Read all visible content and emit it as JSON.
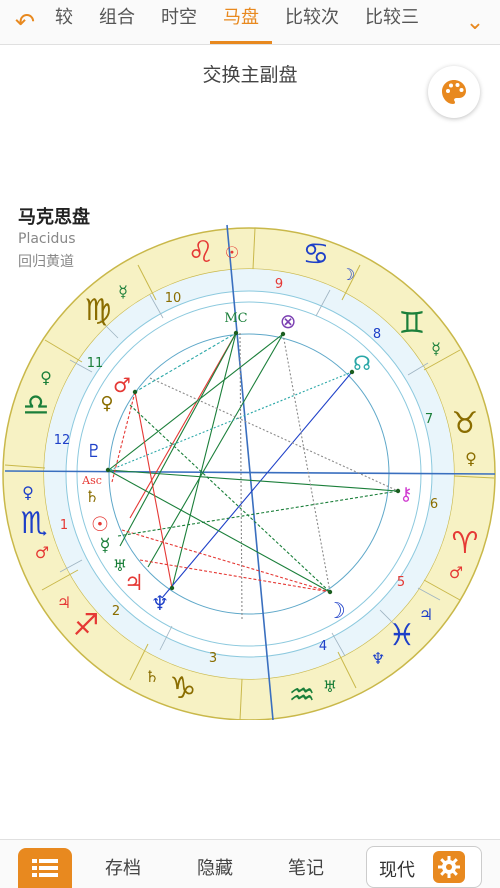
{
  "tabs": {
    "back_icon": "undo-arrow-icon",
    "items": [
      {
        "label": "较",
        "active": false
      },
      {
        "label": "组合",
        "active": false
      },
      {
        "label": "时空",
        "active": false
      },
      {
        "label": "马盘",
        "active": true
      },
      {
        "label": "比较次",
        "active": false
      },
      {
        "label": "比较三",
        "active": false
      }
    ],
    "more_icon": "chevron-down-icon"
  },
  "subtitle": "交换主副盘",
  "palette_icon": "palette-icon",
  "chart_info": {
    "name": "马克思盘",
    "house_system": "Placidus",
    "zodiac": "回归黄道"
  },
  "chart": {
    "house_numbers": [
      "1",
      "2",
      "3",
      "4",
      "5",
      "6",
      "7",
      "8",
      "9",
      "10",
      "11",
      "12"
    ],
    "angles": {
      "mc": "MC",
      "asc": "Asc"
    },
    "colors": {
      "zodiac_ring": "#f7f2c4",
      "house_ring": "#e9f5fb",
      "accent": "#e8891f",
      "fire": "#e53935",
      "earth": "#8a6d00",
      "air": "#1b7f3a",
      "water": "#1e40c8"
    }
  },
  "bottom": {
    "menu_icon": "list-menu-icon",
    "save": "存档",
    "hide": "隐藏",
    "notes": "笔记",
    "modern": "现代",
    "settings_icon": "gear-icon"
  }
}
